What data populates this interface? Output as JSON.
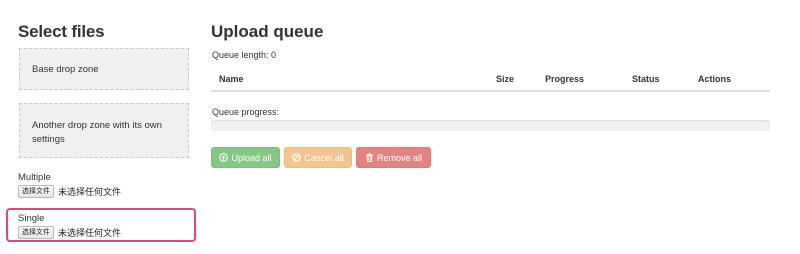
{
  "left": {
    "title": "Select files",
    "dropzones": [
      {
        "label": "Base drop zone"
      },
      {
        "label": "Another drop zone with its own settings"
      }
    ],
    "multiple": {
      "label": "Multiple",
      "button": "选择文件",
      "status": "未选择任何文件"
    },
    "single": {
      "label": "Single",
      "button": "选择文件",
      "status": "未选择任何文件"
    }
  },
  "queue": {
    "title": "Upload queue",
    "length_text": "Queue length: 0",
    "columns": [
      "Name",
      "Size",
      "Progress",
      "Status",
      "Actions"
    ],
    "progress_label": "Queue progress:",
    "progress": 0,
    "buttons": {
      "upload": {
        "label": "Upload all",
        "icon": "upload-icon"
      },
      "cancel": {
        "label": "Cancel all",
        "icon": "ban-icon"
      },
      "remove": {
        "label": "Remove all",
        "icon": "trash-icon"
      }
    }
  },
  "colors": {
    "upload": "#85c785",
    "cancel": "#f4c48f",
    "remove": "#e48481",
    "single_highlight": "#e8437a"
  }
}
